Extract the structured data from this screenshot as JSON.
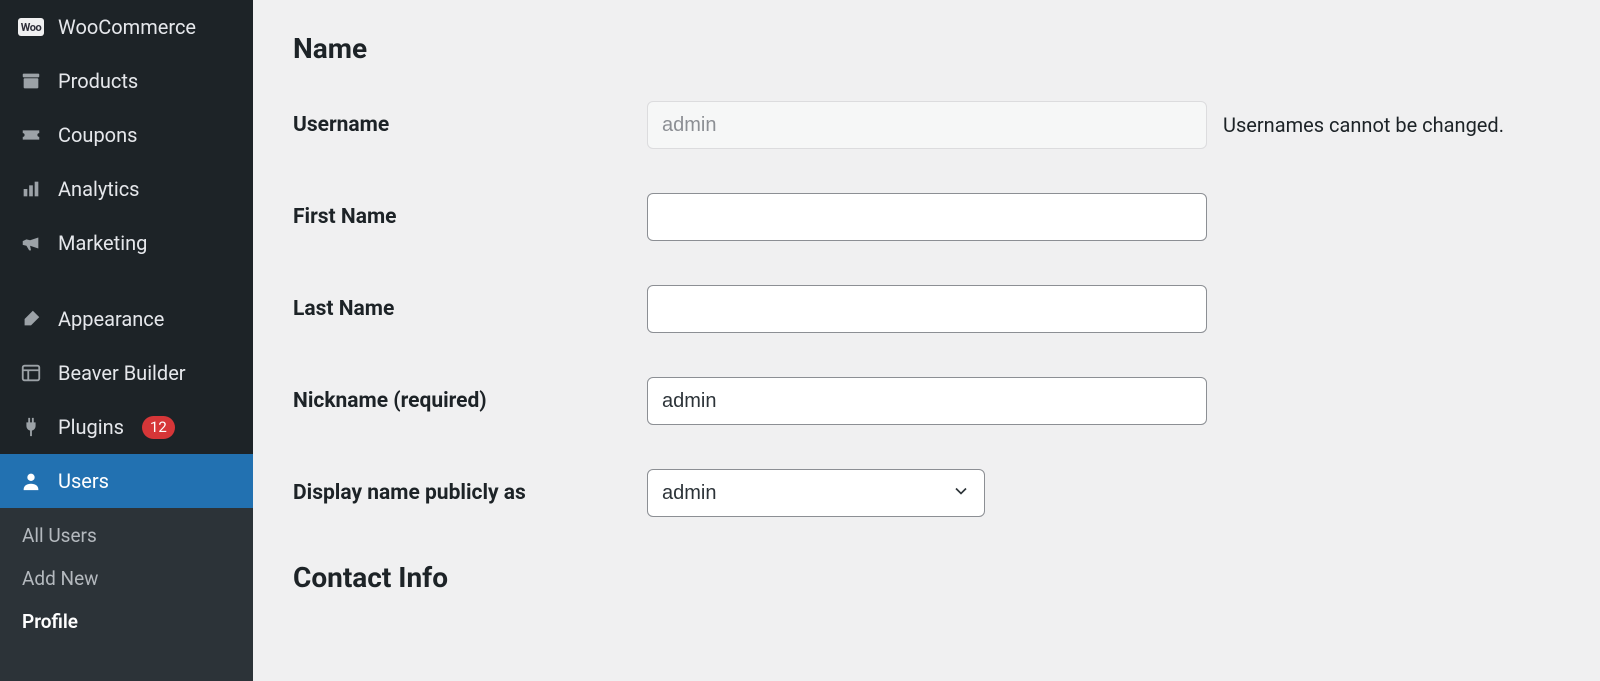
{
  "sidebar": {
    "items": [
      {
        "key": "woocommerce",
        "label": "WooCommerce"
      },
      {
        "key": "products",
        "label": "Products"
      },
      {
        "key": "coupons",
        "label": "Coupons"
      },
      {
        "key": "analytics",
        "label": "Analytics"
      },
      {
        "key": "marketing",
        "label": "Marketing"
      },
      {
        "key": "appearance",
        "label": "Appearance"
      },
      {
        "key": "beaver",
        "label": "Beaver Builder"
      },
      {
        "key": "plugins",
        "label": "Plugins",
        "badge": "12"
      },
      {
        "key": "users",
        "label": "Users",
        "active": true
      }
    ],
    "woo_badge": "Woo",
    "subnav": {
      "all_users": "All Users",
      "add_new": "Add New",
      "profile": "Profile"
    }
  },
  "sections": {
    "name_heading": "Name",
    "contact_heading": "Contact Info"
  },
  "fields": {
    "username": {
      "label": "Username",
      "value": "admin",
      "hint": "Usernames cannot be changed."
    },
    "first_name": {
      "label": "First Name",
      "value": ""
    },
    "last_name": {
      "label": "Last Name",
      "value": ""
    },
    "nickname": {
      "label": "Nickname (required)",
      "value": "admin"
    },
    "display_name": {
      "label": "Display name publicly as",
      "value": "admin"
    }
  }
}
